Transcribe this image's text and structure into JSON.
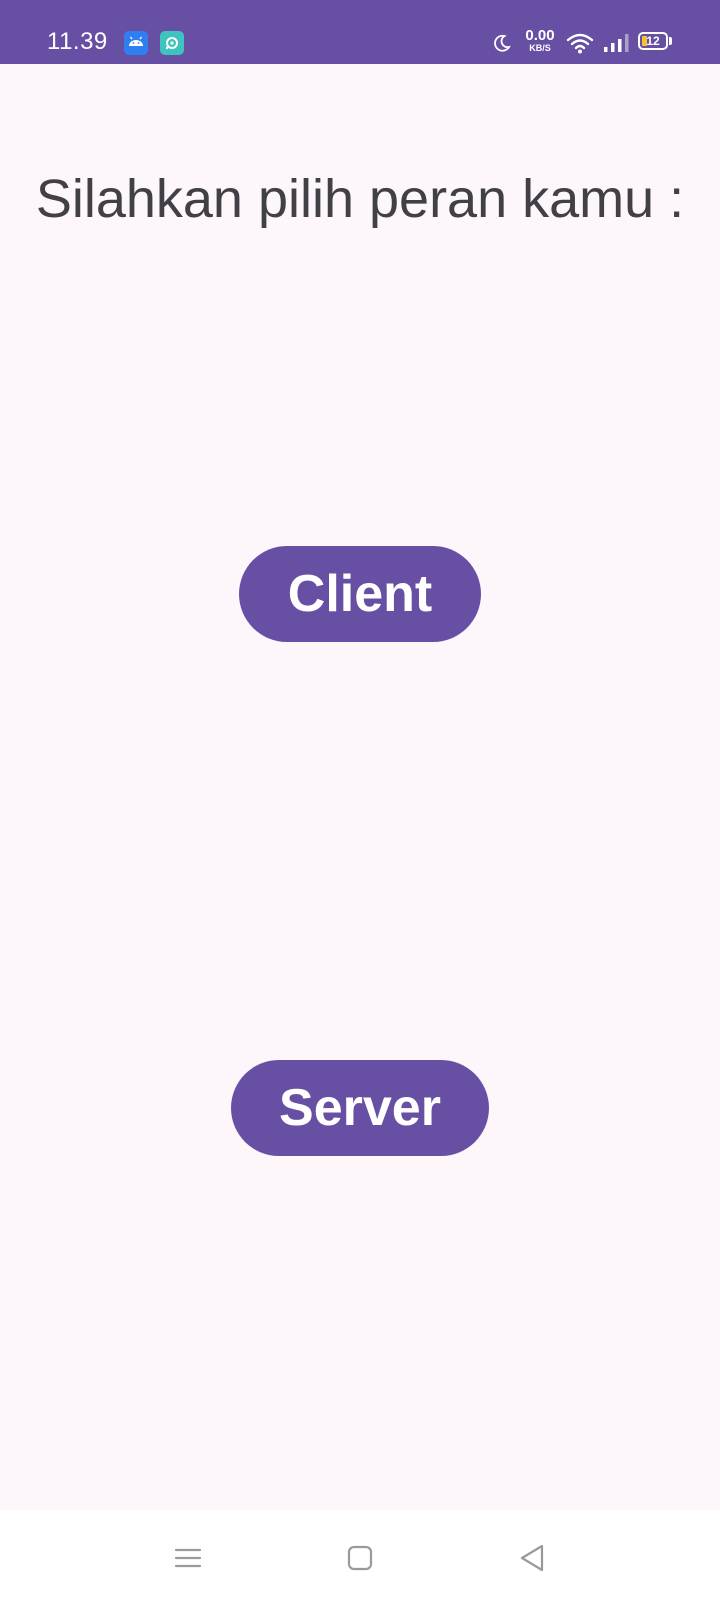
{
  "status_bar": {
    "time": "11.39",
    "netspeed_value": "0.00",
    "netspeed_unit": "KB/S",
    "battery_level": "12",
    "notification_icons": [
      "android-icon",
      "app-notification-icon"
    ],
    "system_icons": [
      "moon-icon",
      "wifi-icon",
      "signal-icon",
      "battery-icon"
    ],
    "background_color": "#6750a4"
  },
  "main": {
    "title": "Silahkan pilih peran kamu :",
    "client_button_label": "Client",
    "server_button_label": "Server",
    "button_color": "#6750a4",
    "background_color": "#fdf7fc"
  },
  "nav_bar": {
    "icons": [
      "menu-icon",
      "home-icon",
      "back-icon"
    ]
  }
}
